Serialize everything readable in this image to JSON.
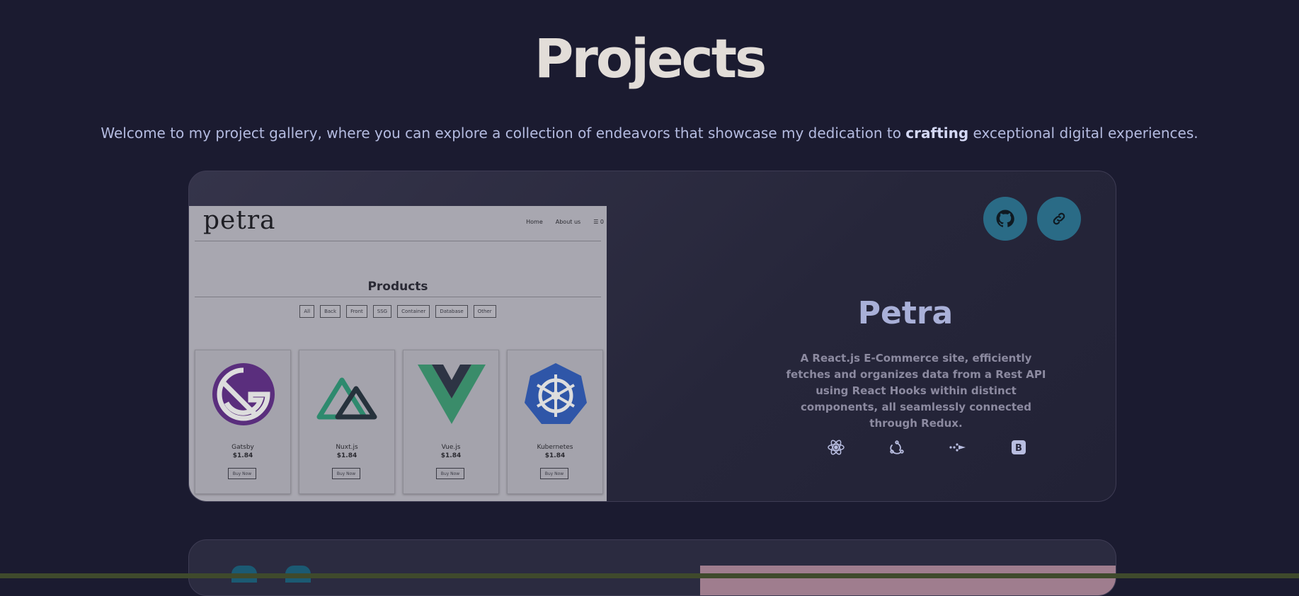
{
  "page": {
    "title": "Projects",
    "intro_before": "Welcome to my project gallery, where you can explore a collection of endeavors that showcase my dedication to ",
    "intro_bold": "crafting",
    "intro_after": " exceptional digital experiences."
  },
  "project": {
    "name": "Petra",
    "description": "A React.js E-Commerce site, efficiently fetches and organizes data from a Rest API using React Hooks within distinct components, all seamlessly connected through Redux.",
    "actions": [
      {
        "icon": "github-icon"
      },
      {
        "icon": "link-icon"
      }
    ],
    "tech_icons": [
      "react-icon",
      "redux-icon",
      "api-icon",
      "bootstrap-icon"
    ],
    "tech_bootstrap_letter": "B",
    "screenshot": {
      "logo": "petra",
      "nav": [
        "Home",
        "About us"
      ],
      "cart_count": "0",
      "heading": "Products",
      "filters": [
        "All",
        "Back",
        "Front",
        "SSG",
        "Container",
        "Database",
        "Other"
      ],
      "products": [
        {
          "name": "Gatsby",
          "price": "$1.84",
          "button": "Buy Now",
          "icon": "gatsby-icon"
        },
        {
          "name": "Nuxt.js",
          "price": "$1.84",
          "button": "Buy Now",
          "icon": "nuxtjs-icon"
        },
        {
          "name": "Vue.js",
          "price": "$1.84",
          "button": "Buy Now",
          "icon": "vuejs-icon"
        },
        {
          "name": "Kubernetes",
          "price": "$1.84",
          "button": "Buy Now",
          "icon": "kubernetes-icon"
        }
      ]
    }
  },
  "colors": {
    "background": "#1b1b30",
    "title": "#e2ddd8",
    "intro": "#b4bbe0",
    "accent_button": "#2a6b86",
    "project_name": "#a9b0d8",
    "description": "#8c8aa0"
  }
}
